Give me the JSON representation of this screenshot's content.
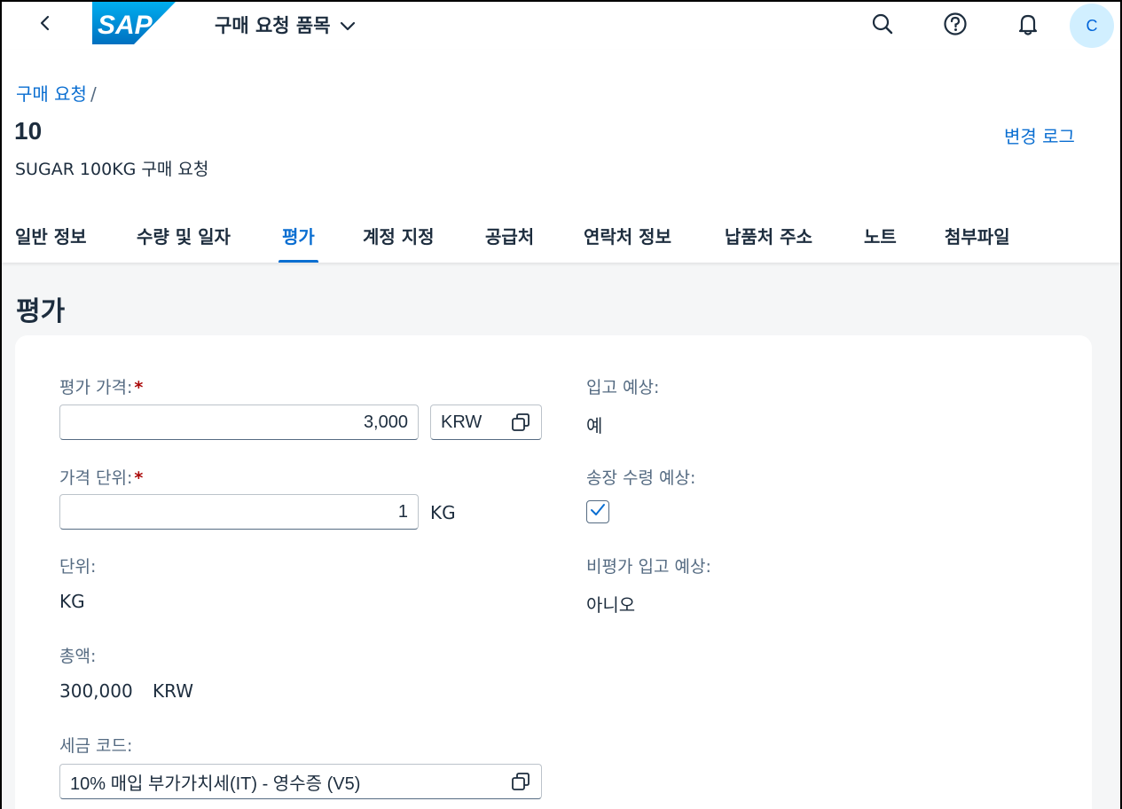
{
  "shell": {
    "logo_text": "SAP",
    "app_title": "구매 요청 품목",
    "avatar_initial": "C",
    "icons": [
      "back-icon",
      "search-icon",
      "help-icon",
      "bell-icon"
    ]
  },
  "header": {
    "breadcrumb": {
      "link": "구매 요청",
      "separator": "/"
    },
    "title": "10",
    "subtitle": "SUGAR 100KG 구매 요청",
    "change_log": "변경 로그"
  },
  "tabs": [
    {
      "label": "일반 정보",
      "active": false
    },
    {
      "label": "수량 및 일자",
      "active": false
    },
    {
      "label": "평가",
      "active": true
    },
    {
      "label": "계정 지정",
      "active": false
    },
    {
      "label": "공급처",
      "active": false
    },
    {
      "label": "연락처 정보",
      "active": false
    },
    {
      "label": "납품처 주소",
      "active": false
    },
    {
      "label": "노트",
      "active": false
    },
    {
      "label": "첨부파일",
      "active": false
    }
  ],
  "section": {
    "title": "평가",
    "valuation_price": {
      "label": "평가 가격:",
      "required_mark": "*",
      "value": "3,000",
      "currency": "KRW"
    },
    "price_unit": {
      "label": "가격 단위:",
      "required_mark": "*",
      "value": "1",
      "unit": "KG"
    },
    "unit": {
      "label": "단위:",
      "value": "KG"
    },
    "total": {
      "label": "총액:",
      "value": "300,000",
      "currency": "KRW"
    },
    "tax_code": {
      "label": "세금 코드:",
      "value": "10% 매입 부가가치세(IT) - 영수증 (V5)"
    },
    "goods_receipt": {
      "label": "입고 예상:",
      "value": "예"
    },
    "invoice_receipt": {
      "label": "송장 수령 예상:",
      "checked": true
    },
    "nonvaluated_gr": {
      "label": "비평가 입고 예상:",
      "value": "아니오"
    }
  },
  "colors": {
    "accent": "#0a6ed1",
    "text": "#1d2d3e",
    "label": "#556b82",
    "required": "#aa0808",
    "avatar_bg": "#d1efff",
    "logo_blue": "#0a6ed1"
  }
}
